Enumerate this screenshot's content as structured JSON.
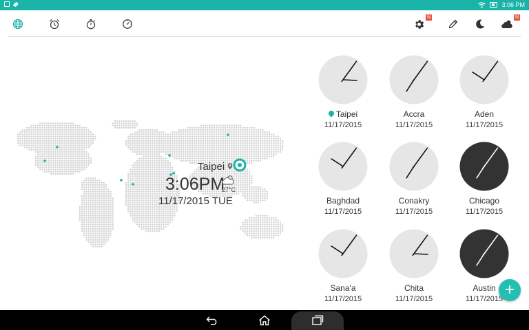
{
  "status_bar": {
    "time": "3:06 PM"
  },
  "toolbar": {
    "tabs": [
      {
        "name": "world-clock",
        "icon": "globe-icon",
        "active": true
      },
      {
        "name": "alarm",
        "icon": "alarm-icon"
      },
      {
        "name": "stopwatch",
        "icon": "stopwatch-icon"
      },
      {
        "name": "timer",
        "icon": "timer-icon"
      }
    ],
    "settings_badge": "N",
    "weather_badge": "N"
  },
  "local": {
    "city": "Taipei",
    "time": "3:06PM",
    "date": "11/17/2015 TUE",
    "temperature": "27°C"
  },
  "clocks": [
    {
      "city": "Taipei",
      "date": "11/17/2015",
      "hour_angle": 93,
      "minute_angle": 36,
      "dark": false,
      "current": true
    },
    {
      "city": "Accra",
      "date": "11/17/2015",
      "hour_angle": 213,
      "minute_angle": 36,
      "dark": false,
      "current": false
    },
    {
      "city": "Aden",
      "date": "11/17/2015",
      "hour_angle": 303,
      "minute_angle": 36,
      "dark": false,
      "current": false
    },
    {
      "city": "Baghdad",
      "date": "11/17/2015",
      "hour_angle": 303,
      "minute_angle": 36,
      "dark": false,
      "current": false
    },
    {
      "city": "Conakry",
      "date": "11/17/2015",
      "hour_angle": 213,
      "minute_angle": 36,
      "dark": false,
      "current": false
    },
    {
      "city": "Chicago",
      "date": "11/17/2015",
      "hour_angle": 213,
      "minute_angle": 36,
      "dark": true,
      "current": false
    },
    {
      "city": "Sana'a",
      "date": "11/17/2015",
      "hour_angle": 303,
      "minute_angle": 36,
      "dark": false,
      "current": false
    },
    {
      "city": "Chita",
      "date": "11/17/2015",
      "hour_angle": 93,
      "minute_angle": 36,
      "dark": false,
      "current": false
    },
    {
      "city": "Austin",
      "date": "11/17/2015",
      "hour_angle": 213,
      "minute_angle": 36,
      "dark": true,
      "current": false
    }
  ],
  "fab": {
    "label": "+"
  },
  "colors": {
    "accent": "#19b3a8",
    "clock_light": "#e6e6e6",
    "clock_dark": "#333333",
    "badge": "#e8533f",
    "map_dot": "#cfcfcf"
  }
}
